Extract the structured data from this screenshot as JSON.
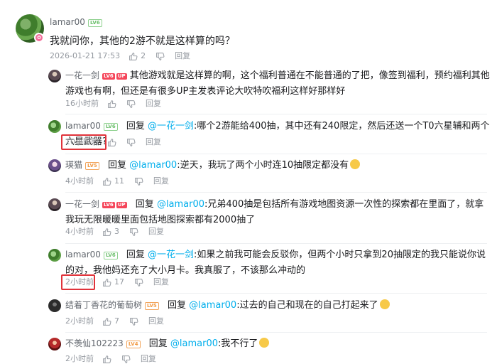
{
  "root": {
    "username": "lamar00",
    "level": "LV6",
    "text": "我就问你，其他的2游不就是这样算的吗？",
    "timestamp": "2026-01-21 17:53",
    "likes": "2",
    "reply_label": "回复"
  },
  "replies": [
    {
      "username": "一花一剑",
      "level": "LV6",
      "up_tag": "UP",
      "reply_to": "",
      "text": "其他游戏就是这样算的啊，这个福利普通在不能普通的了把，像签到福利，预约福利其他游戏也有啊，但还是有很多UP主发表评论大吹特吹福利这样好那样好",
      "timestamp": "16小时前",
      "likes": "",
      "reply_label": "回复"
    },
    {
      "username": "lamar00",
      "level": "LV6",
      "reply_prefix": "回复",
      "reply_to": "@一花一剑",
      "text": ":哪个2游能给400抽，其中还有240限定，然后还送一个T0六星辅和两个六星武器?",
      "timestamp": "10小时前",
      "likes": "",
      "reply_label": "回复"
    },
    {
      "username": "瑛猫",
      "level": "LV5",
      "reply_prefix": "回复",
      "reply_to": "@lamar00",
      "text": ":逆天，我玩了两个小时连10抽限定都没有",
      "timestamp": "4小时前",
      "likes": "11",
      "reply_label": "回复"
    },
    {
      "username": "一花一剑",
      "level": "LV6",
      "up_tag": "UP",
      "reply_prefix": "回复",
      "reply_to": "@lamar00",
      "text": ":兄弟400抽是包括所有游戏地图资源一次性的探索都在里面了，就拿我玩无限暖暖里面包括地图探索都有2000抽了",
      "timestamp": "4小时前",
      "likes": "3",
      "reply_label": "回复"
    },
    {
      "username": "lamar00",
      "level": "LV6",
      "reply_prefix": "回复",
      "reply_to": "@一花一剑",
      "text": ":如果之前我可能会反驳你，但两个小时只拿到20抽限定的我只能说你说的对，我他妈还充了大小月卡。我真服了，不该那么冲动的",
      "timestamp": "2小时前",
      "likes": "17",
      "reply_label": "回复"
    },
    {
      "username": "结着丁香花的葡萄树",
      "level": "LV5",
      "reply_prefix": "回复",
      "reply_to": "@lamar00",
      "text": ":过去的自己和现在的自己打起来了",
      "timestamp": "2小时前",
      "likes": "7",
      "reply_label": "回复"
    },
    {
      "username": "不羡仙102223",
      "level": "LV4",
      "reply_prefix": "回复",
      "reply_to": "@lamar00",
      "text": ":我不行了",
      "timestamp": "2小时前",
      "likes": "",
      "reply_label": "回复"
    }
  ],
  "colors": {
    "mention": "#00aeec",
    "meta": "#9499a0",
    "highlight_box": "#e0323a"
  }
}
